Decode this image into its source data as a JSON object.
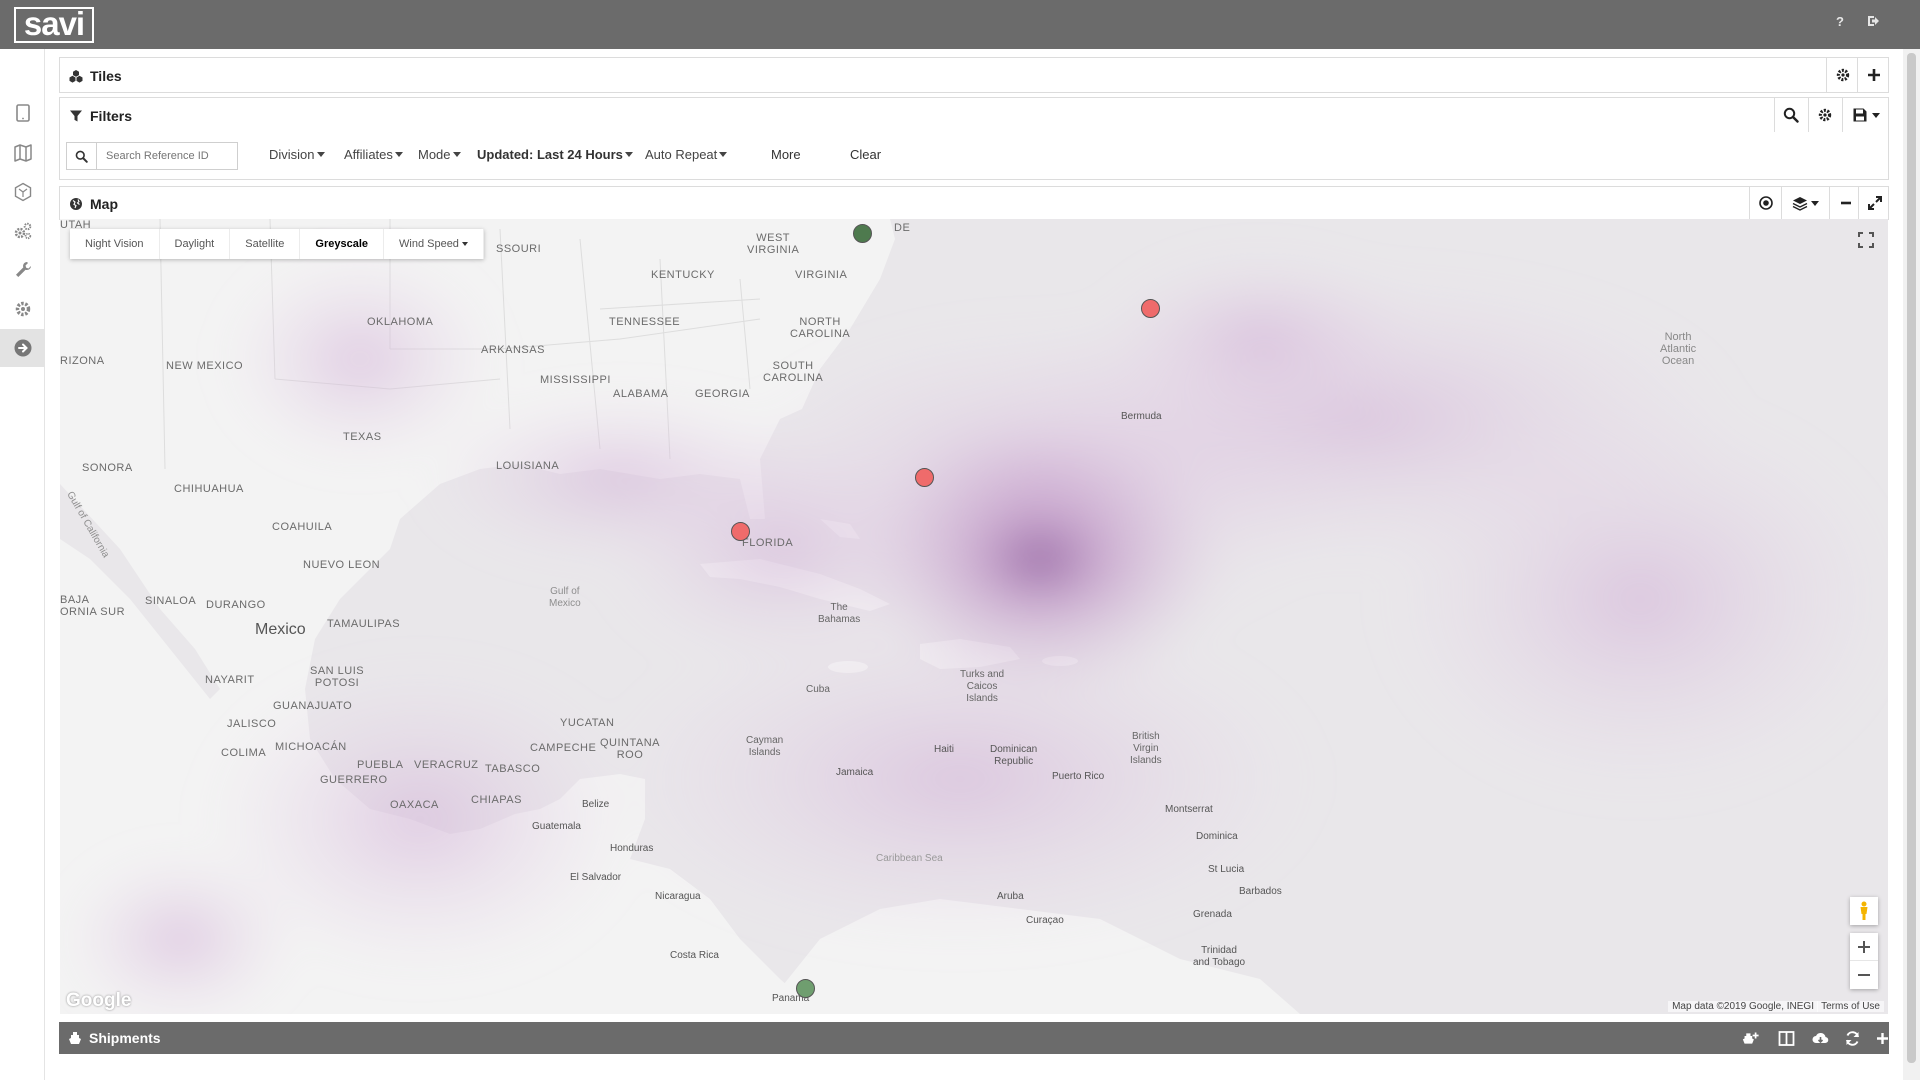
{
  "app": {
    "logo_text": "savi"
  },
  "header": {
    "help_icon": "question-icon",
    "logout_icon": "sign-out-icon"
  },
  "sidebar": {
    "items": [
      {
        "icon": "tablet-icon"
      },
      {
        "icon": "map-icon"
      },
      {
        "icon": "hexagon-network-icon"
      },
      {
        "icon": "gears-icon"
      },
      {
        "icon": "wrench-icon"
      },
      {
        "icon": "gear-icon"
      },
      {
        "icon": "arrow-circle-right-icon",
        "active": true
      }
    ]
  },
  "tiles_panel": {
    "title": "Tiles"
  },
  "filters_panel": {
    "title": "Filters",
    "search_placeholder": "Search Reference ID",
    "dropdowns": {
      "division": "Division",
      "affiliates": "Affiliates",
      "mode": "Mode",
      "updated": "Updated: Last 24 Hours",
      "auto_repeat": "Auto Repeat"
    },
    "more_label": "More",
    "clear_label": "Clear"
  },
  "map_panel": {
    "title": "Map",
    "map_types": [
      "Night Vision",
      "Daylight",
      "Satellite",
      "Greyscale",
      "Wind Speed"
    ],
    "selected_map_type": "Greyscale",
    "labels": {
      "utah": "UTAH",
      "missouri": "SSOURI",
      "west_virginia": "WEST\nVIRGINIA",
      "de": "DE",
      "kentucky": "KENTUCKY",
      "virginia": "VIRGINIA",
      "oklahoma": "OKLAHOMA",
      "tennessee": "TENNESSEE",
      "north_carolina": "NORTH\nCAROLINA",
      "arizona": "RIZONA",
      "new_mexico": "NEW MEXICO",
      "arkansas": "ARKANSAS",
      "south_carolina": "SOUTH\nCAROLINA",
      "mississippi": "MISSISSIPPI",
      "alabama": "ALABAMA",
      "georgia": "GEORGIA",
      "texas": "TEXAS",
      "sonora": "SONORA",
      "louisiana": "LOUISIANA",
      "chihuahua": "CHIHUAHUA",
      "coahuila": "COAHUILA",
      "florida": "FLORIDA",
      "nuevo_leon": "NUEVO LEON",
      "gulf_of_california": "Gulf of California",
      "gulf_of_mexico": "Gulf of\nMexico",
      "baja": "BAJA\nORNIA SUR",
      "sinaloa": "SINALOA",
      "durango": "DURANGO",
      "bahamas": "The\nBahamas",
      "tamaulipas": "TAMAULIPAS",
      "mexico": "Mexico",
      "nayarit": "NAYARIT",
      "san_luis_potosi": "SAN LUIS\nPOTOSI",
      "turks_caicos": "Turks and\nCaicos\nIslands",
      "cuba": "Cuba",
      "guanajuato": "GUANAJUATO",
      "jalisco": "JALISCO",
      "yucatan": "YUCATAN",
      "colima": "COLIMA",
      "michoacan": "MICHOACÁN",
      "campeche": "CAMPECHE",
      "quintana_roo": "QUINTANA\nROO",
      "cayman": "Cayman\nIslands",
      "haiti": "Haiti",
      "dominican": "Dominican\nRepublic",
      "bvi": "British\nVirgin\nIslands",
      "puebla": "PUEBLA",
      "veracruz": "VERACRUZ",
      "tabasco": "TABASCO",
      "guerrero": "GUERRERO",
      "jamaica": "Jamaica",
      "puerto_rico": "Puerto Rico",
      "oaxaca": "OAXACA",
      "chiapas": "CHIAPAS",
      "belize": "Belize",
      "montserrat": "Montserrat",
      "guatemala": "Guatemala",
      "dominica": "Dominica",
      "honduras": "Honduras",
      "caribbean": "Caribbean Sea",
      "el_salvador": "El Salvador",
      "st_lucia": "St Lucia",
      "barbados": "Barbados",
      "nicaragua": "Nicaragua",
      "aruba": "Aruba",
      "grenada": "Grenada",
      "curacao": "Curaçao",
      "costa_rica": "Costa Rica",
      "trinidad": "Trinidad\nand Tobago",
      "panama": "Panama",
      "bermuda": "Bermuda",
      "north_atlantic": "North\nAtlantic\nOcean"
    },
    "markers": [
      {
        "status": "green",
        "color": "#4e7a4e"
      },
      {
        "status": "red",
        "color": "#ef6b6b"
      },
      {
        "status": "red",
        "color": "#ef6b6b"
      },
      {
        "status": "red",
        "color": "#ef6b6b"
      },
      {
        "status": "green",
        "color": "#6f9e6f"
      }
    ],
    "attribution": "Map data ©2019 Google, INEGI",
    "terms": "Terms of Use",
    "google_logo": "Google"
  },
  "shipments_panel": {
    "title": "Shipments"
  },
  "colors": {
    "topbar": "#6b6b6b",
    "marker_red": "#ef6b6b",
    "marker_green": "#4e7a4e",
    "weather_overlay": "#b98ac0"
  }
}
